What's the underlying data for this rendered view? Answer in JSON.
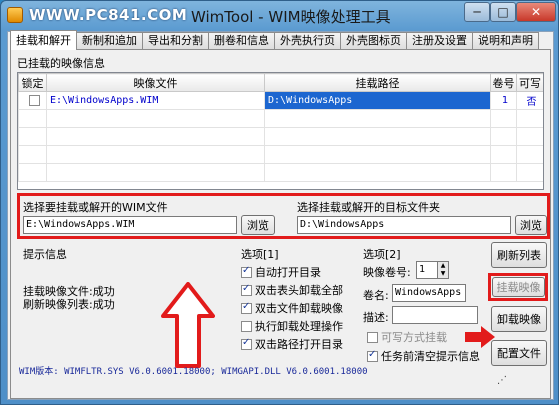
{
  "window": {
    "watermark": "WWW.PC841.COM",
    "title": "WimTool - WIM映像处理工具",
    "min_label": "─",
    "max_label": "□",
    "close_label": "✕"
  },
  "tabs": [
    "挂载和解开",
    "新制和追加",
    "导出和分割",
    "删卷和信息",
    "外壳执行页",
    "外壳图标页",
    "注册及设置",
    "说明和声明"
  ],
  "mounted": {
    "section_label": "已挂载的映像信息",
    "columns": [
      "锁定",
      "映像文件",
      "挂载路径",
      "卷号",
      "可写"
    ],
    "rows": [
      {
        "locked": false,
        "image_file": "E:\\WindowsApps.WIM",
        "mount_path": "D:\\WindowsApps",
        "volume": "1",
        "writable": "否"
      }
    ]
  },
  "selection": {
    "wim_label": "选择要挂载或解开的WIM文件",
    "wim_value": "E:\\WindowsApps.WIM",
    "wim_browse": "浏览",
    "target_label": "选择挂载或解开的目标文件夹",
    "target_value": "D:\\WindowsApps",
    "target_browse": "浏览"
  },
  "info": {
    "label": "提示信息",
    "line1": "挂载映像文件:成功",
    "line2": "刷新映像列表:成功"
  },
  "options1": {
    "label": "选项[1]",
    "items": [
      {
        "text": "自动打开目录",
        "checked": true
      },
      {
        "text": "双击表头卸载全部",
        "checked": true
      },
      {
        "text": "双击文件卸载映像",
        "checked": true
      },
      {
        "text": "执行卸载处理操作",
        "checked": false
      },
      {
        "text": "双击路径打开目录",
        "checked": true
      }
    ]
  },
  "options2": {
    "label": "选项[2]",
    "volume_label": "映像卷号:",
    "volume_value": "1",
    "name_label": "卷名:",
    "name_value": "WindowsApps",
    "desc_label": "描述:",
    "desc_value": "",
    "writable_label": "可写方式挂载",
    "writable_checked": false,
    "clear_label": "任务前清空提示信息",
    "clear_checked": true
  },
  "actions": {
    "refresh": "刷新列表",
    "mount": "挂载映像",
    "unmount": "卸载映像",
    "config": "配置文件"
  },
  "status": "WIM版本: WIMFLTR.SYS V6.0.6001.18000; WIMGAPI.DLL V6.0.6001.18000",
  "colors": {
    "annotation_red": "#e21b1b",
    "selected_path_bg": "#1c66d0"
  }
}
